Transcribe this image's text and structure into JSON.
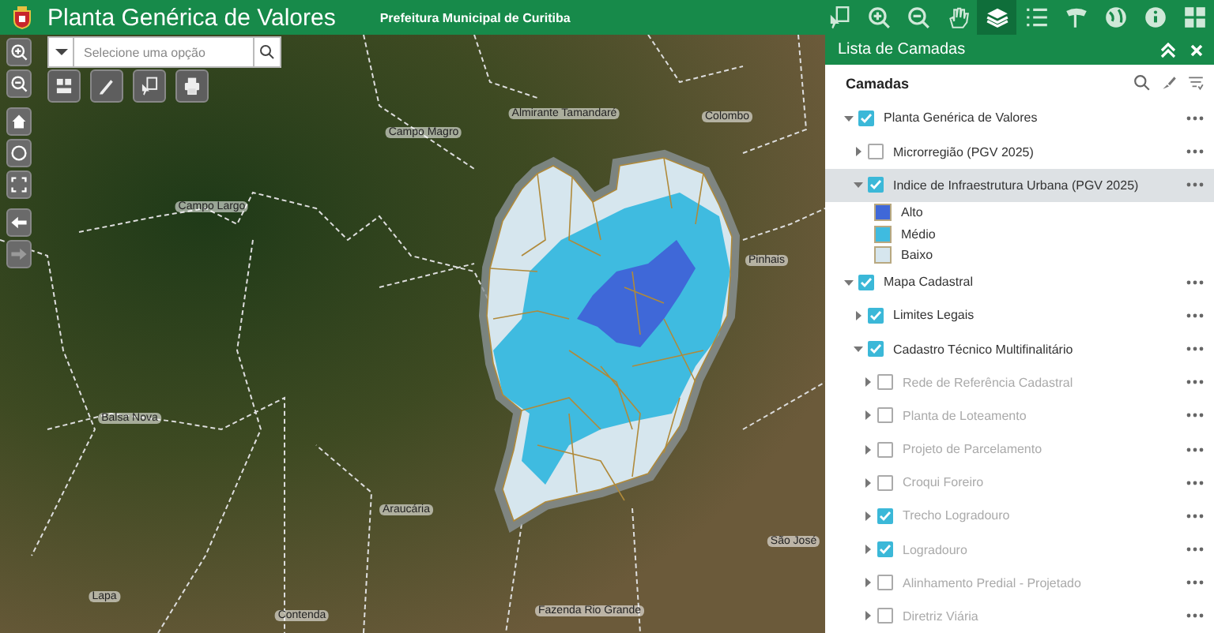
{
  "header": {
    "title": "Planta Genérica de Valores",
    "subtitle": "Prefeitura Municipal de Curitiba"
  },
  "toolbar": [
    {
      "kind": "select",
      "selected": false
    },
    {
      "kind": "zoom-in",
      "selected": false
    },
    {
      "kind": "zoom-out",
      "selected": false
    },
    {
      "kind": "pan",
      "selected": false
    },
    {
      "kind": "layers",
      "selected": true
    },
    {
      "kind": "legend",
      "selected": false
    },
    {
      "kind": "signpost",
      "selected": false
    },
    {
      "kind": "globe",
      "selected": false
    },
    {
      "kind": "info",
      "selected": false
    },
    {
      "kind": "grid",
      "selected": false
    }
  ],
  "search": {
    "placeholder": "Selecione uma opção"
  },
  "map_tools": [
    {
      "kind": "layout"
    },
    {
      "kind": "pencil"
    },
    {
      "kind": "select"
    },
    {
      "kind": "print"
    }
  ],
  "nav_controls": [
    {
      "kind": "zoom-in",
      "disabled": false
    },
    {
      "kind": "zoom-out",
      "disabled": false
    },
    {
      "kind": "home",
      "disabled": false
    },
    {
      "kind": "locate",
      "disabled": false
    },
    {
      "kind": "fullscreen",
      "disabled": false
    },
    {
      "kind": "back",
      "disabled": false
    },
    {
      "kind": "forward",
      "disabled": true
    }
  ],
  "map_labels": [
    "Almirante Tamandaré",
    "Colombo",
    "Campo Magro",
    "Campo Largo",
    "Pinhais",
    "Balsa Nova",
    "Araucária",
    "São José",
    "Lapa",
    "Contenda",
    "Fazenda Rio Grande"
  ],
  "layer_panel": {
    "title": "Lista de Camadas",
    "heading": "Camadas",
    "layers": [
      {
        "label": "Planta Genérica de Valores",
        "checked": true,
        "expanded": true,
        "selected": false,
        "disabled": false,
        "children": [
          {
            "label": "Microrregião (PGV 2025)",
            "checked": false,
            "expanded": false,
            "selected": false,
            "disabled": false
          },
          {
            "label": "Indice de Infraestrutura Urbana (PGV 2025)",
            "checked": true,
            "expanded": true,
            "selected": true,
            "disabled": false,
            "legend": [
              {
                "label": "Alto",
                "color": "#3f68d8"
              },
              {
                "label": "Médio",
                "color": "#3fbbe0"
              },
              {
                "label": "Baixo",
                "color": "#d6e6ee"
              }
            ]
          }
        ]
      },
      {
        "label": "Mapa Cadastral",
        "checked": true,
        "expanded": true,
        "selected": false,
        "disabled": false,
        "children": [
          {
            "label": "Limites Legais",
            "checked": true,
            "expanded": false,
            "selected": false,
            "disabled": false
          },
          {
            "label": "Cadastro Técnico Multifinalitário",
            "checked": true,
            "expanded": true,
            "selected": false,
            "disabled": false,
            "children": [
              {
                "label": "Rede de Referência Cadastral",
                "checked": false,
                "expanded": false,
                "selected": false,
                "disabled": true
              },
              {
                "label": "Planta de Loteamento",
                "checked": false,
                "expanded": false,
                "selected": false,
                "disabled": true
              },
              {
                "label": "Projeto de Parcelamento",
                "checked": false,
                "expanded": false,
                "selected": false,
                "disabled": true
              },
              {
                "label": "Croqui Foreiro",
                "checked": false,
                "expanded": false,
                "selected": false,
                "disabled": true
              },
              {
                "label": "Trecho Logradouro",
                "checked": true,
                "expanded": false,
                "selected": false,
                "disabled": true
              },
              {
                "label": "Logradouro",
                "checked": true,
                "expanded": false,
                "selected": false,
                "disabled": true
              },
              {
                "label": "Alinhamento Predial - Projetado",
                "checked": false,
                "expanded": false,
                "selected": false,
                "disabled": true
              },
              {
                "label": "Diretriz Viária",
                "checked": false,
                "expanded": false,
                "selected": false,
                "disabled": true
              }
            ]
          }
        ]
      }
    ]
  }
}
